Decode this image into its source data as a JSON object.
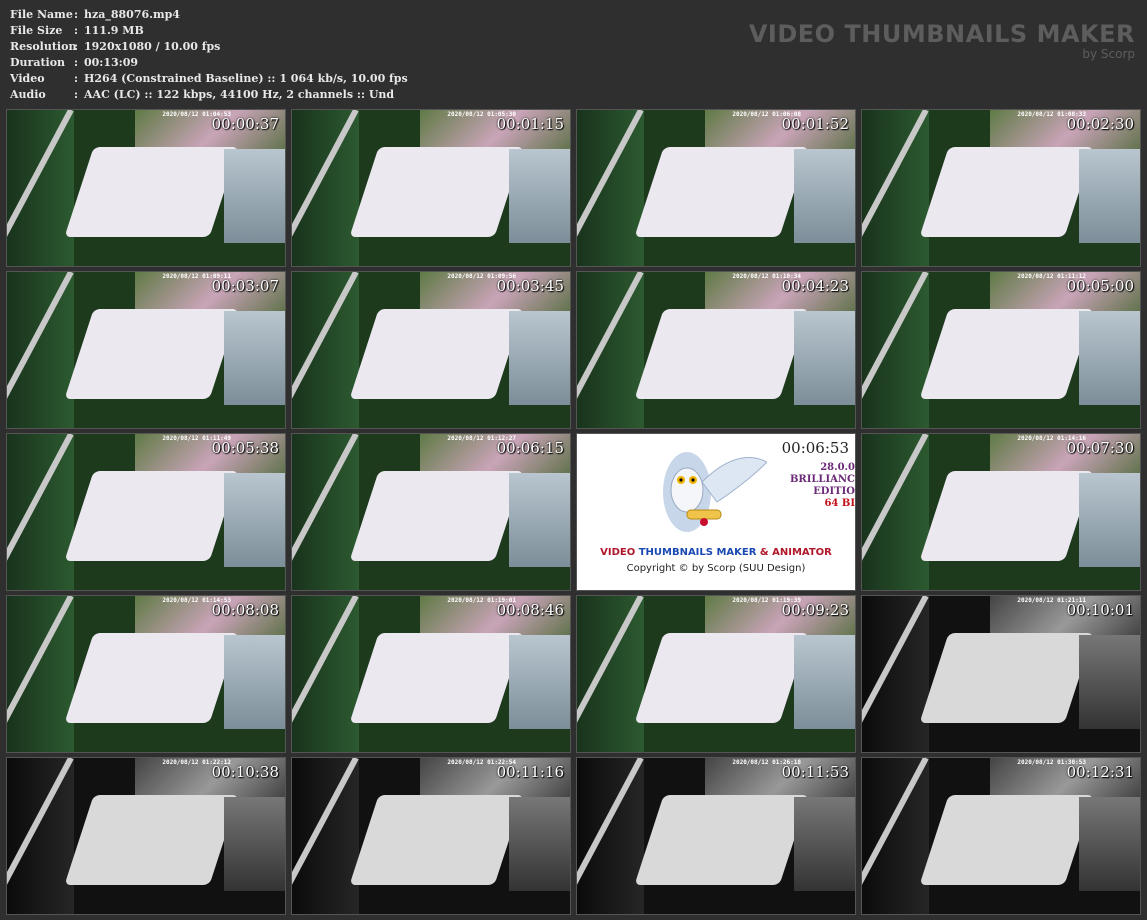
{
  "info": {
    "file_name": {
      "label": "File Name",
      "value": "hza_88076.mp4"
    },
    "file_size": {
      "label": "File Size",
      "value": "111.9 MB"
    },
    "resolution": {
      "label": "Resolution",
      "value": "1920x1080 / 10.00 fps"
    },
    "duration": {
      "label": "Duration",
      "value": "00:13:09"
    },
    "video": {
      "label": "Video",
      "value": "H264 (Constrained Baseline) :: 1 064 kb/s, 10.00 fps"
    },
    "audio": {
      "label": "Audio",
      "value": "AAC (LC) :: 122 kbps, 44100 Hz, 2 channels :: Und"
    }
  },
  "brand": {
    "title": "VIDEO THUMBNAILS MAKER",
    "subtitle": "by Scorp"
  },
  "thumbs": [
    {
      "stamp": "2020/08/12 01:04:53",
      "time": "00:00:37",
      "kind": "day"
    },
    {
      "stamp": "2020/08/12 01:05:30",
      "time": "00:01:15",
      "kind": "day"
    },
    {
      "stamp": "2020/08/12 01:06:08",
      "time": "00:01:52",
      "kind": "day"
    },
    {
      "stamp": "2020/08/12 01:08:33",
      "time": "00:02:30",
      "kind": "day"
    },
    {
      "stamp": "2020/08/12 01:09:11",
      "time": "00:03:07",
      "kind": "day"
    },
    {
      "stamp": "2020/08/12 01:09:56",
      "time": "00:03:45",
      "kind": "day"
    },
    {
      "stamp": "2020/08/12 01:10:34",
      "time": "00:04:23",
      "kind": "day"
    },
    {
      "stamp": "2020/08/12 01:11:12",
      "time": "00:05:00",
      "kind": "day"
    },
    {
      "stamp": "2020/08/12 01:11:49",
      "time": "00:05:38",
      "kind": "day"
    },
    {
      "stamp": "2020/08/12 01:12:27",
      "time": "00:06:15",
      "kind": "day"
    },
    {
      "stamp": "",
      "time": "00:06:53",
      "kind": "logo"
    },
    {
      "stamp": "2020/08/12 01:14:16",
      "time": "00:07:30",
      "kind": "day"
    },
    {
      "stamp": "2020/08/12 01:14:53",
      "time": "00:08:08",
      "kind": "day"
    },
    {
      "stamp": "2020/08/12 01:19:01",
      "time": "00:08:46",
      "kind": "day"
    },
    {
      "stamp": "2020/08/12 01:19:39",
      "time": "00:09:23",
      "kind": "day"
    },
    {
      "stamp": "2020/08/12 01:21:11",
      "time": "00:10:01",
      "kind": "night"
    },
    {
      "stamp": "2020/08/12 01:22:12",
      "time": "00:10:38",
      "kind": "night"
    },
    {
      "stamp": "2020/08/12 01:22:54",
      "time": "00:11:16",
      "kind": "night"
    },
    {
      "stamp": "2020/08/12 01:26:18",
      "time": "00:11:53",
      "kind": "night"
    },
    {
      "stamp": "2020/08/12 01:30:53",
      "time": "00:12:31",
      "kind": "night"
    }
  ],
  "logo_frame": {
    "line1_a": "VIDEO ",
    "line1_b": "THUMBNAILS MAKER",
    "line1_c": " & ANIMATOR",
    "copyright": "Copyright © by Scorp (SUU Design)",
    "side1": "28.0.0",
    "side2": "BRILLIANC",
    "side3": "EDITIO",
    "side4": "64 BI"
  }
}
